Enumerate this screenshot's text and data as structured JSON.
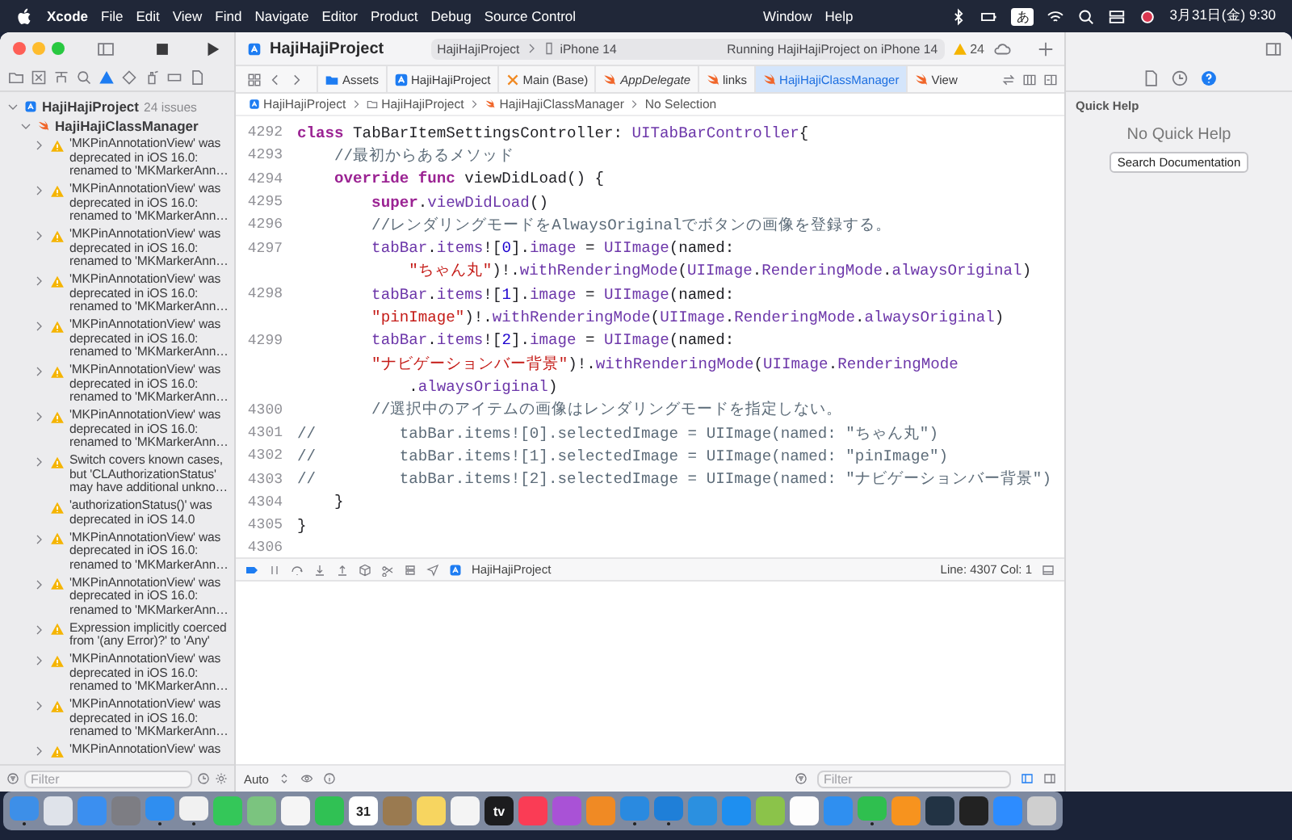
{
  "menu_bar": {
    "app": "Xcode",
    "menus": [
      "File",
      "Edit",
      "View",
      "Find",
      "Navigate",
      "Editor",
      "Product",
      "Debug",
      "Source Control"
    ],
    "more_menus": [
      "Window",
      "Help"
    ],
    "input_mode": "あ",
    "clock": "3月31日(金) 9:30"
  },
  "toolbar": {
    "title": "HajiHajiProject",
    "scheme": "HajiHajiProject",
    "device": "iPhone 14",
    "status": "Running HajiHajiProject on iPhone 14",
    "warning_count": "24"
  },
  "issue_navigator": {
    "project": "HajiHajiProject",
    "issue_count": "24 issues",
    "file": "HajiHajiClassManager",
    "issues": [
      {
        "text": "'MKPinAnnotationView' was deprecated in iOS 16.0: renamed to 'MKMarkerAnn…",
        "expandable": true
      },
      {
        "text": "'MKPinAnnotationView' was deprecated in iOS 16.0: renamed to 'MKMarkerAnn…",
        "expandable": true
      },
      {
        "text": "'MKPinAnnotationView' was deprecated in iOS 16.0: renamed to 'MKMarkerAnn…",
        "expandable": true
      },
      {
        "text": "'MKPinAnnotationView' was deprecated in iOS 16.0: renamed to 'MKMarkerAnn…",
        "expandable": true
      },
      {
        "text": "'MKPinAnnotationView' was deprecated in iOS 16.0: renamed to 'MKMarkerAnn…",
        "expandable": true
      },
      {
        "text": "'MKPinAnnotationView' was deprecated in iOS 16.0: renamed to 'MKMarkerAnn…",
        "expandable": true
      },
      {
        "text": "'MKPinAnnotationView' was deprecated in iOS 16.0: renamed to 'MKMarkerAnn…",
        "expandable": true
      },
      {
        "text": "Switch covers known cases, but 'CLAuthorizationStatus' may have additional unkno…",
        "expandable": true
      },
      {
        "text": "'authorizationStatus()' was deprecated in iOS 14.0",
        "expandable": false
      },
      {
        "text": "'MKPinAnnotationView' was deprecated in iOS 16.0: renamed to 'MKMarkerAnn…",
        "expandable": true
      },
      {
        "text": "'MKPinAnnotationView' was deprecated in iOS 16.0: renamed to 'MKMarkerAnn…",
        "expandable": true
      },
      {
        "text": "Expression implicitly coerced from '(any Error)?' to 'Any'",
        "expandable": true
      },
      {
        "text": "'MKPinAnnotationView' was deprecated in iOS 16.0: renamed to 'MKMarkerAnn…",
        "expandable": true
      },
      {
        "text": "'MKPinAnnotationView' was deprecated in iOS 16.0: renamed to 'MKMarkerAnn…",
        "expandable": true
      },
      {
        "text": "'MKPinAnnotationView' was",
        "expandable": true
      }
    ],
    "filter": {
      "placeholder": "Filter"
    }
  },
  "tabs": [
    {
      "label": "Assets",
      "kind": "assets",
      "selected": false,
      "preview": false
    },
    {
      "label": "HajiHajiProject",
      "kind": "project",
      "selected": false,
      "preview": false
    },
    {
      "label": "Main (Base)",
      "kind": "storyboard",
      "selected": false,
      "preview": false
    },
    {
      "label": "AppDelegate",
      "kind": "swift",
      "selected": false,
      "preview": true
    },
    {
      "label": "links",
      "kind": "swift",
      "selected": false,
      "preview": false
    },
    {
      "label": "HajiHajiClassManager",
      "kind": "swift",
      "selected": true,
      "preview": false
    },
    {
      "label": "View",
      "kind": "swift",
      "selected": false,
      "preview": false
    }
  ],
  "breadcrumbs": [
    {
      "label": "HajiHajiProject",
      "kind": "project"
    },
    {
      "label": "HajiHajiProject",
      "kind": "folder"
    },
    {
      "label": "HajiHajiClassManager",
      "kind": "swift"
    },
    {
      "label": "No Selection",
      "kind": "none"
    }
  ],
  "code": [
    {
      "number": "4292",
      "tokens": [
        {
          "kind": "kw",
          "text": "class"
        },
        {
          "kind": "plain",
          "text": " TabBarItemSettingsController: "
        },
        {
          "kind": "type",
          "text": "UITabBarController"
        },
        {
          "kind": "plain",
          "text": "{"
        }
      ]
    },
    {
      "number": "4293",
      "tokens": [
        {
          "kind": "comment",
          "text": "    //最初からあるメソッド"
        }
      ]
    },
    {
      "number": "4294",
      "tokens": [
        {
          "kind": "kw",
          "text": "    override func"
        },
        {
          "kind": "plain",
          "text": " viewDidLoad() {"
        }
      ]
    },
    {
      "number": "4295",
      "tokens": [
        {
          "kind": "kw",
          "text": "        super"
        },
        {
          "kind": "plain",
          "text": "."
        },
        {
          "kind": "type",
          "text": "viewDidLoad"
        },
        {
          "kind": "plain",
          "text": "()"
        }
      ]
    },
    {
      "number": "4296",
      "tokens": [
        {
          "kind": "comment",
          "text": "        //レンダリングモードをAlwaysOriginalでボタンの画像を登録する。"
        }
      ]
    },
    {
      "number": "4297",
      "tokens": [
        {
          "kind": "type",
          "text": "        tabBar"
        },
        {
          "kind": "plain",
          "text": "."
        },
        {
          "kind": "type",
          "text": "items"
        },
        {
          "kind": "plain",
          "text": "!["
        },
        {
          "kind": "num",
          "text": "0"
        },
        {
          "kind": "plain",
          "text": "]."
        },
        {
          "kind": "type",
          "text": "image"
        },
        {
          "kind": "plain",
          "text": " = "
        },
        {
          "kind": "type",
          "text": "UIImage"
        },
        {
          "kind": "plain",
          "text": "(named:"
        }
      ]
    },
    {
      "tokens": [
        {
          "kind": "str",
          "text": "            \"ちゃん丸\""
        },
        {
          "kind": "plain",
          "text": ")!."
        },
        {
          "kind": "type",
          "text": "withRenderingMode"
        },
        {
          "kind": "plain",
          "text": "("
        },
        {
          "kind": "type",
          "text": "UIImage"
        },
        {
          "kind": "plain",
          "text": "."
        },
        {
          "kind": "type",
          "text": "RenderingMode"
        },
        {
          "kind": "plain",
          "text": "."
        },
        {
          "kind": "type",
          "text": "alwaysOriginal"
        },
        {
          "kind": "plain",
          "text": ")"
        }
      ]
    },
    {
      "number": "4298",
      "tokens": [
        {
          "kind": "type",
          "text": "        tabBar"
        },
        {
          "kind": "plain",
          "text": "."
        },
        {
          "kind": "type",
          "text": "items"
        },
        {
          "kind": "plain",
          "text": "!["
        },
        {
          "kind": "num",
          "text": "1"
        },
        {
          "kind": "plain",
          "text": "]."
        },
        {
          "kind": "type",
          "text": "image"
        },
        {
          "kind": "plain",
          "text": " = "
        },
        {
          "kind": "type",
          "text": "UIImage"
        },
        {
          "kind": "plain",
          "text": "(named:"
        }
      ]
    },
    {
      "tokens": [
        {
          "kind": "str",
          "text": "        \"pinImage\""
        },
        {
          "kind": "plain",
          "text": ")!."
        },
        {
          "kind": "type",
          "text": "withRenderingMode"
        },
        {
          "kind": "plain",
          "text": "("
        },
        {
          "kind": "type",
          "text": "UIImage"
        },
        {
          "kind": "plain",
          "text": "."
        },
        {
          "kind": "type",
          "text": "RenderingMode"
        },
        {
          "kind": "plain",
          "text": "."
        },
        {
          "kind": "type",
          "text": "alwaysOriginal"
        },
        {
          "kind": "plain",
          "text": ")"
        }
      ]
    },
    {
      "number": "4299",
      "tokens": [
        {
          "kind": "type",
          "text": "        tabBar"
        },
        {
          "kind": "plain",
          "text": "."
        },
        {
          "kind": "type",
          "text": "items"
        },
        {
          "kind": "plain",
          "text": "!["
        },
        {
          "kind": "num",
          "text": "2"
        },
        {
          "kind": "plain",
          "text": "]."
        },
        {
          "kind": "type",
          "text": "image"
        },
        {
          "kind": "plain",
          "text": " = "
        },
        {
          "kind": "type",
          "text": "UIImage"
        },
        {
          "kind": "plain",
          "text": "(named:"
        }
      ]
    },
    {
      "tokens": [
        {
          "kind": "str",
          "text": "        \"ナビゲーションバー背景\""
        },
        {
          "kind": "plain",
          "text": ")!."
        },
        {
          "kind": "type",
          "text": "withRenderingMode"
        },
        {
          "kind": "plain",
          "text": "("
        },
        {
          "kind": "type",
          "text": "UIImage"
        },
        {
          "kind": "plain",
          "text": "."
        },
        {
          "kind": "type",
          "text": "RenderingMode"
        }
      ]
    },
    {
      "tokens": [
        {
          "kind": "plain",
          "text": "            ."
        },
        {
          "kind": "type",
          "text": "alwaysOriginal"
        },
        {
          "kind": "plain",
          "text": ")"
        }
      ]
    },
    {
      "number": "4300",
      "tokens": [
        {
          "kind": "comment",
          "text": "        //選択中のアイテムの画像はレンダリングモードを指定しない。"
        }
      ]
    },
    {
      "number": "4301",
      "tokens": [
        {
          "kind": "comment",
          "text": "//         tabBar.items![0].selectedImage = UIImage(named: \"ちゃん丸\")"
        }
      ]
    },
    {
      "number": "4302",
      "tokens": [
        {
          "kind": "comment",
          "text": "//         tabBar.items![1].selectedImage = UIImage(named: \"pinImage\")"
        }
      ]
    },
    {
      "number": "4303",
      "tokens": [
        {
          "kind": "comment",
          "text": "//         tabBar.items![2].selectedImage = UIImage(named: \"ナビゲーションバー背景\")"
        }
      ]
    },
    {
      "number": "4304",
      "tokens": [
        {
          "kind": "plain",
          "text": "    }"
        }
      ]
    },
    {
      "number": "4305",
      "tokens": [
        {
          "kind": "plain",
          "text": "}"
        }
      ]
    },
    {
      "number": "4306"
    }
  ],
  "debug_bar": {
    "target": "HajiHajiProject",
    "position": "Line: 4307  Col: 1"
  },
  "console_bar": {
    "mode": "Auto",
    "filter": {
      "placeholder": "Filter"
    }
  },
  "inspector": {
    "title": "Quick Help",
    "message": "No Quick Help",
    "button": "Search Documentation"
  },
  "dock": [
    {
      "color": "#3d8fe8",
      "running": true
    },
    {
      "color": "#dfe3ea",
      "running": false
    },
    {
      "color": "#3b8ff0",
      "running": false
    },
    {
      "color": "#7d7d83",
      "running": false
    },
    {
      "color": "#2f8ef0",
      "running": true
    },
    {
      "color": "#f1f1f1",
      "running": true
    },
    {
      "color": "#34c759",
      "running": false
    },
    {
      "color": "#7bc47f",
      "running": false
    },
    {
      "color": "#f5f5f5",
      "running": false
    },
    {
      "color": "#30c154",
      "running": false
    },
    {
      "color": "#ffffff",
      "running": false,
      "label": "31"
    },
    {
      "color": "#9a7a50",
      "running": false
    },
    {
      "color": "#f7d560",
      "running": false
    },
    {
      "color": "#f4f4f4",
      "running": false
    },
    {
      "color": "#1c1c1e",
      "running": false,
      "label": "tv"
    },
    {
      "color": "#fa3c55",
      "running": false
    },
    {
      "color": "#a952d6",
      "running": false
    },
    {
      "color": "#f08a24",
      "running": false
    },
    {
      "color": "#2a8ae0",
      "running": true
    },
    {
      "color": "#1f7fd8",
      "running": true
    },
    {
      "color": "#2b90e0",
      "running": false
    },
    {
      "color": "#1e8ff0",
      "running": false
    },
    {
      "color": "#8bc34a",
      "running": false
    },
    {
      "color": "#fdfdfd",
      "running": false
    },
    {
      "color": "#2f8ff0",
      "running": false
    },
    {
      "color": "#2fbf4f",
      "running": true
    },
    {
      "color": "#f7931e",
      "running": false
    },
    {
      "color": "#223344",
      "running": false
    },
    {
      "color": "#222222",
      "running": false
    },
    {
      "color": "#2d8cff",
      "running": false
    },
    {
      "color": "#cfcfcf",
      "running": false
    }
  ]
}
